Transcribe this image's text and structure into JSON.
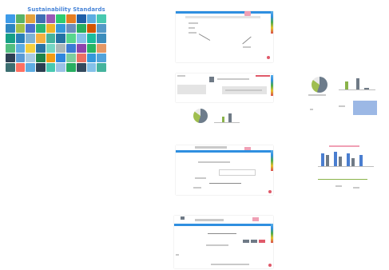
{
  "header": {
    "title": "Sustainability Standards"
  },
  "mosaic_colors": [
    "#3d9be9",
    "#58b368",
    "#e4a23d",
    "#3e6fb5",
    "#9b59b6",
    "#2ecc71",
    "#e67e22",
    "#1f5fa8",
    "#5dade2",
    "#48c9b0",
    "#2e86c1",
    "#a3c14a",
    "#4a6fd1",
    "#2bb673",
    "#f0b429",
    "#3498db",
    "#6c8ebf",
    "#27ae60",
    "#d35400",
    "#5499c7",
    "#16a085",
    "#2980b9",
    "#7fb3d5",
    "#f5b041",
    "#45b39d",
    "#2471a3",
    "#58d68d",
    "#85c1e9",
    "#1abc9c",
    "#3c8dbc",
    "#52be80",
    "#5dade2",
    "#f4d03f",
    "#2874a6",
    "#76d7c4",
    "#aab7b8",
    "#3a7bd5",
    "#8e44ad",
    "#28b463",
    "#e59866",
    "#2e4053",
    "#5b9bd5",
    "#a9cce3",
    "#1e8449",
    "#f39c12",
    "#2e86de",
    "#7dcea0",
    "#ec7063",
    "#3498db",
    "#52a3db",
    "#3c6e71",
    "#ff6f61",
    "#5dade2",
    "#2c3e50",
    "#48c9b0",
    "#9bc2e6",
    "#27ae60",
    "#34495e",
    "#85c1e9",
    "#45b39d"
  ]
}
